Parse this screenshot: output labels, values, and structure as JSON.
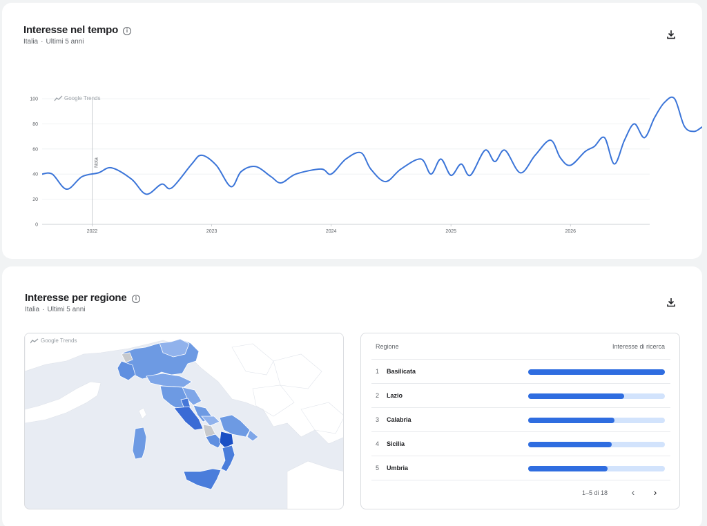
{
  "time_card": {
    "title": "Interesse nel tempo",
    "subtitle_location": "Italia",
    "subtitle_period": "Ultimi 5 anni",
    "watermark": "Google Trends",
    "note_label": "Nota"
  },
  "region_card": {
    "title": "Interesse per regione",
    "subtitle_location": "Italia",
    "subtitle_period": "Ultimi 5 anni",
    "map_watermark": "Google Trends",
    "table": {
      "col_region": "Regione",
      "col_interest": "Interesse di ricerca",
      "rows": [
        {
          "rank": "1",
          "name": "Basilicata",
          "value": 100
        },
        {
          "rank": "2",
          "name": "Lazio",
          "value": 70
        },
        {
          "rank": "3",
          "name": "Calabria",
          "value": 63
        },
        {
          "rank": "4",
          "name": "Sicilia",
          "value": 61
        },
        {
          "rank": "5",
          "name": "Umbria",
          "value": 58
        }
      ],
      "pager": "1–5 di 18"
    }
  },
  "colors": {
    "line": "#3a74d8",
    "bar_fill": "#2f6de0",
    "bar_track": "#d2e3fc"
  },
  "icons": {
    "info": "info-icon",
    "download": "download-icon",
    "prev": "chevron-left-icon",
    "next": "chevron-right-icon"
  },
  "chart_data": {
    "type": "line",
    "title": "",
    "xlabel": "",
    "ylabel": "",
    "ylim": [
      0,
      100
    ],
    "yticks": [
      0,
      20,
      40,
      60,
      80,
      100
    ],
    "xticks": [
      {
        "label": "2022",
        "x": "2022-01-01"
      },
      {
        "label": "2023",
        "x": "2023-01-01"
      },
      {
        "label": "2024",
        "x": "2024-01-01"
      },
      {
        "label": "2025",
        "x": "2025-01-01"
      },
      {
        "label": "2026",
        "x": "2026-01-01"
      }
    ],
    "grid": true,
    "x_start": "2021-08-01",
    "x_end": "2026-08-31",
    "note_at": "2022-01-01",
    "series": [
      {
        "points": [
          [
            "2021-08-01",
            40
          ],
          [
            "2021-09-01",
            40
          ],
          [
            "2021-10-15",
            28
          ],
          [
            "2021-12-01",
            38
          ],
          [
            "2022-01-20",
            41
          ],
          [
            "2022-03-01",
            45
          ],
          [
            "2022-05-01",
            36
          ],
          [
            "2022-06-15",
            24
          ],
          [
            "2022-08-01",
            32
          ],
          [
            "2022-09-01",
            29
          ],
          [
            "2022-11-01",
            48
          ],
          [
            "2022-12-01",
            55
          ],
          [
            "2023-01-15",
            47
          ],
          [
            "2023-03-01",
            30
          ],
          [
            "2023-04-01",
            42
          ],
          [
            "2023-05-15",
            46
          ],
          [
            "2023-07-01",
            38
          ],
          [
            "2023-08-01",
            33
          ],
          [
            "2023-09-15",
            40
          ],
          [
            "2023-12-01",
            44
          ],
          [
            "2024-01-01",
            40
          ],
          [
            "2024-02-15",
            52
          ],
          [
            "2024-04-01",
            57
          ],
          [
            "2024-05-01",
            44
          ],
          [
            "2024-06-15",
            34
          ],
          [
            "2024-08-01",
            44
          ],
          [
            "2024-10-01",
            52
          ],
          [
            "2024-11-01",
            40
          ],
          [
            "2024-12-01",
            52
          ],
          [
            "2025-01-01",
            39
          ],
          [
            "2025-02-01",
            48
          ],
          [
            "2025-03-01",
            39
          ],
          [
            "2025-04-15",
            59
          ],
          [
            "2025-05-15",
            50
          ],
          [
            "2025-06-15",
            59
          ],
          [
            "2025-08-01",
            41
          ],
          [
            "2025-09-15",
            55
          ],
          [
            "2025-11-01",
            67
          ],
          [
            "2025-12-01",
            53
          ],
          [
            "2026-01-01",
            47
          ],
          [
            "2026-02-15",
            58
          ],
          [
            "2026-03-15",
            62
          ],
          [
            "2026-04-15",
            69
          ],
          [
            "2026-05-15",
            48
          ],
          [
            "2026-06-15",
            67
          ],
          [
            "2026-07-15",
            80
          ],
          [
            "2026-08-15",
            69
          ],
          [
            "2026-09-15",
            85
          ],
          [
            "2026-10-15",
            97
          ],
          [
            "2026-11-15",
            100
          ],
          [
            "2026-12-15",
            78
          ],
          [
            "2027-01-15",
            74
          ],
          [
            "2027-02-15",
            78
          ],
          [
            "2027-03-15",
            72
          ],
          [
            "2027-04-15",
            70
          ],
          [
            "2027-05-15",
            57
          ]
        ],
        "partial_points": [
          [
            "2027-05-15",
            57
          ],
          [
            "2027-06-15",
            76
          ]
        ]
      }
    ]
  }
}
